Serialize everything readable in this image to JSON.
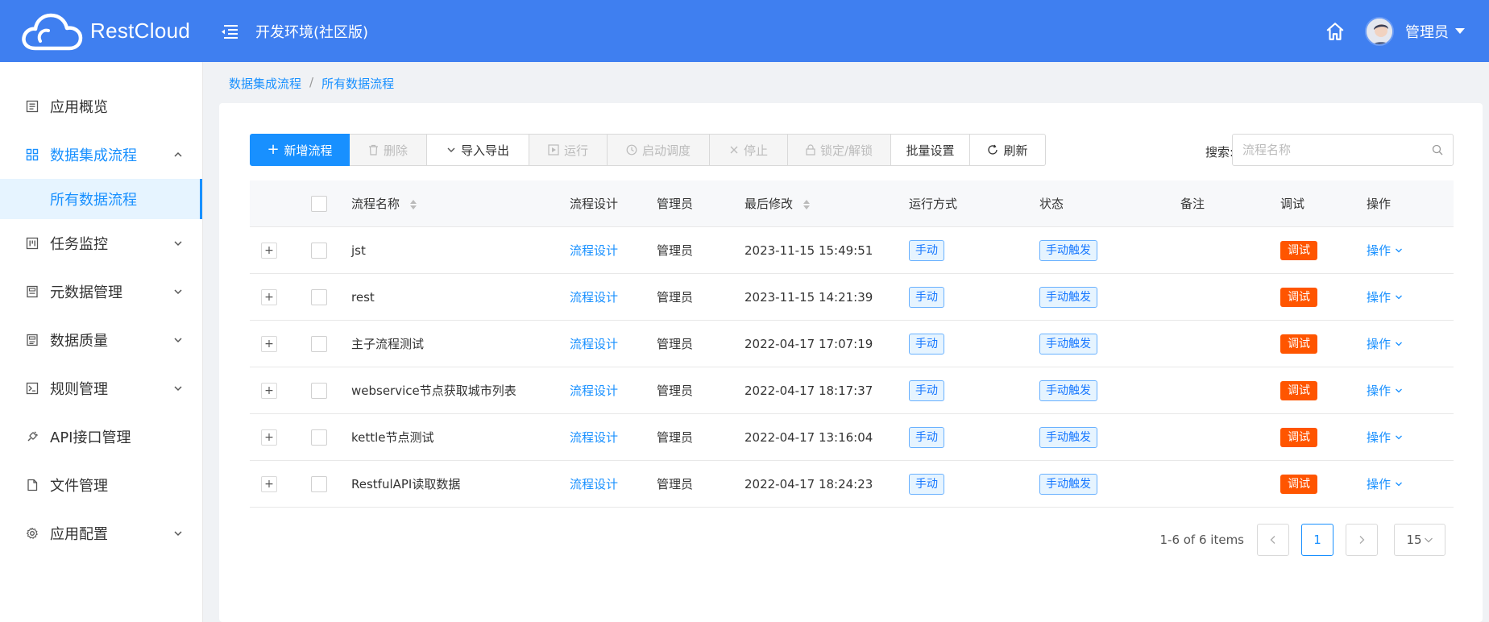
{
  "app": {
    "brand": "RestCloud",
    "env_title": "开发环境(社区版)",
    "user": "管理员"
  },
  "sidebar": {
    "items": [
      {
        "label": "应用概览",
        "icon": "overview-icon"
      },
      {
        "label": "数据集成流程",
        "icon": "grid-icon",
        "expanded": true
      },
      {
        "label": "任务监控",
        "icon": "monitor-icon"
      },
      {
        "label": "元数据管理",
        "icon": "metadata-icon"
      },
      {
        "label": "数据质量",
        "icon": "quality-icon"
      },
      {
        "label": "规则管理",
        "icon": "rules-icon"
      },
      {
        "label": "API接口管理",
        "icon": "api-icon"
      },
      {
        "label": "文件管理",
        "icon": "file-icon"
      },
      {
        "label": "应用配置",
        "icon": "gear-icon"
      }
    ],
    "active_sub": "所有数据流程"
  },
  "breadcrumb": [
    "数据集成流程",
    "所有数据流程"
  ],
  "toolbar": {
    "add": "新增流程",
    "delete": "删除",
    "import_export": "导入导出",
    "run": "运行",
    "schedule": "启动调度",
    "stop": "停止",
    "lock": "锁定/解锁",
    "batch": "批量设置",
    "refresh": "刷新"
  },
  "search": {
    "label": "搜索:",
    "placeholder": "流程名称"
  },
  "table": {
    "headers": {
      "name": "流程名称",
      "design": "流程设计",
      "admin": "管理员",
      "modified": "最后修改",
      "run_mode": "运行方式",
      "status": "状态",
      "note": "备注",
      "debug": "调试",
      "ops": "操作"
    },
    "rows": [
      {
        "name": "jst",
        "design": "流程设计",
        "admin": "管理员",
        "modified": "2023-11-15 15:49:51",
        "run_mode": "手动",
        "status": "手动触发",
        "note": "",
        "debug": "调试",
        "ops": "操作"
      },
      {
        "name": "rest",
        "design": "流程设计",
        "admin": "管理员",
        "modified": "2023-11-15 14:21:39",
        "run_mode": "手动",
        "status": "手动触发",
        "note": "",
        "debug": "调试",
        "ops": "操作"
      },
      {
        "name": "主子流程测试",
        "design": "流程设计",
        "admin": "管理员",
        "modified": "2022-04-17 17:07:19",
        "run_mode": "手动",
        "status": "手动触发",
        "note": "",
        "debug": "调试",
        "ops": "操作"
      },
      {
        "name": "webservice节点获取城市列表",
        "design": "流程设计",
        "admin": "管理员",
        "modified": "2022-04-17 18:17:37",
        "run_mode": "手动",
        "status": "手动触发",
        "note": "",
        "debug": "调试",
        "ops": "操作"
      },
      {
        "name": "kettle节点测试",
        "design": "流程设计",
        "admin": "管理员",
        "modified": "2022-04-17 13:16:04",
        "run_mode": "手动",
        "status": "手动触发",
        "note": "",
        "debug": "调试",
        "ops": "操作"
      },
      {
        "name": "RestfulAPI读取数据",
        "design": "流程设计",
        "admin": "管理员",
        "modified": "2022-04-17 18:24:23",
        "run_mode": "手动",
        "status": "手动触发",
        "note": "",
        "debug": "调试",
        "ops": "操作"
      }
    ]
  },
  "pagination": {
    "info": "1-6 of 6 items",
    "current": "1",
    "page_size": "15"
  },
  "colors": {
    "header_bg": "#3f7ff0",
    "primary": "#1890ff",
    "debug_tag": "#ff5500"
  }
}
